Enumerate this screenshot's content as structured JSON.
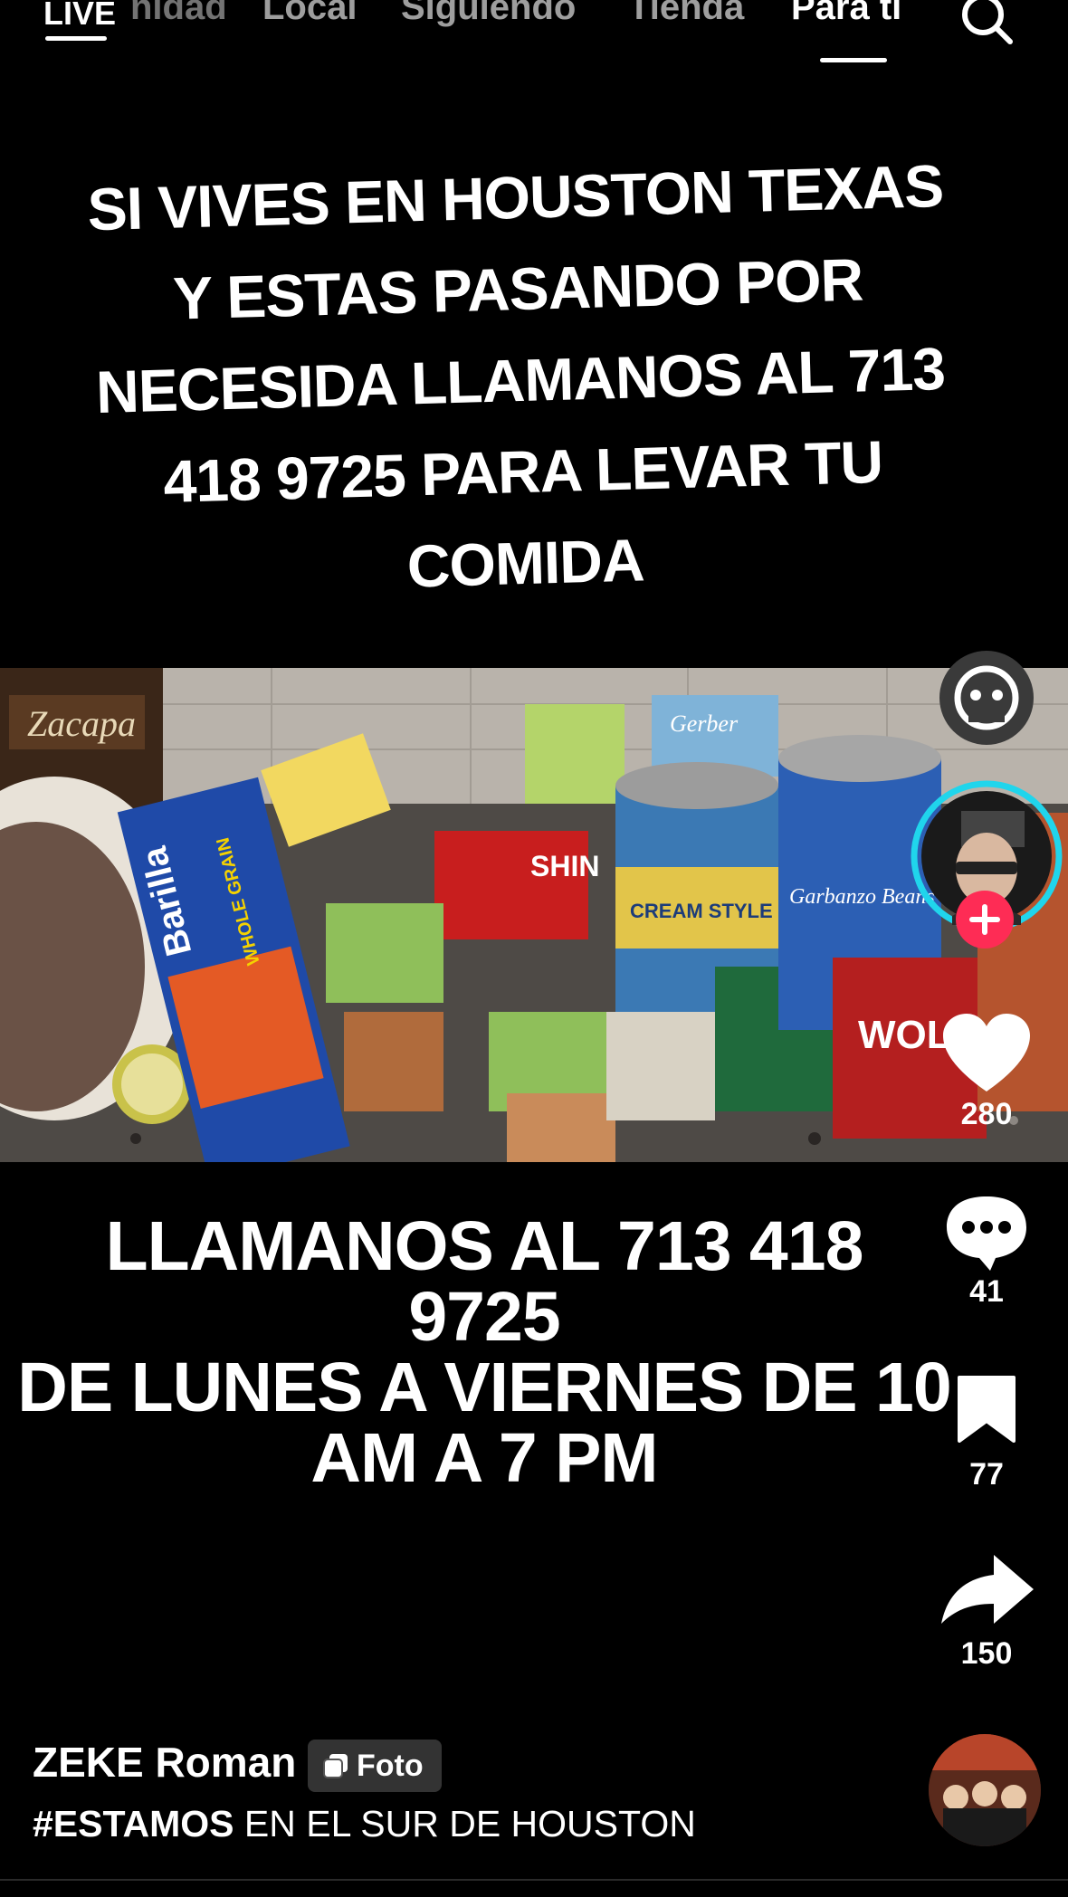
{
  "nav": {
    "live_label": "LIVE",
    "tabs": [
      {
        "label": "nidad"
      },
      {
        "label": "Local"
      },
      {
        "label": "Siguiendo"
      },
      {
        "label": "Tienda"
      },
      {
        "label": "Para ti",
        "active": true
      }
    ]
  },
  "post": {
    "headline": "SI VIVES EN HOUSTON TEXAS Y ESTAS PASANDO POR NECESIDA LLAMANOS AL 713 418 9725 PARA LEVAR TU COMIDA",
    "subline": "LLAMANOS AL 713 418\n9725\nDE LUNES A VIERNES DE 10\nAM A 7 PM",
    "photo_products": {
      "pasta_brand": "Barilla",
      "pasta_type": "WHOLE GRAIN",
      "noodle_brand": "SHIN",
      "can_1": "CREAM STYLE",
      "can_2": "Garbanzo Beans",
      "can_3": "WOLF",
      "rum_label": "Zacapa",
      "baby_food": "Gerber"
    }
  },
  "rail": {
    "likes": "280",
    "comments": "41",
    "saves": "77",
    "shares": "150"
  },
  "author": {
    "name": "ZEKE Roman",
    "badge": "Foto"
  },
  "caption": {
    "hashtag": "#ESTAMOS",
    "text": " EN EL SUR DE HOUSTON"
  },
  "colors": {
    "background": "#000000",
    "follow_plus": "#fe2c55",
    "avatar_ring": "#20d5ec"
  }
}
